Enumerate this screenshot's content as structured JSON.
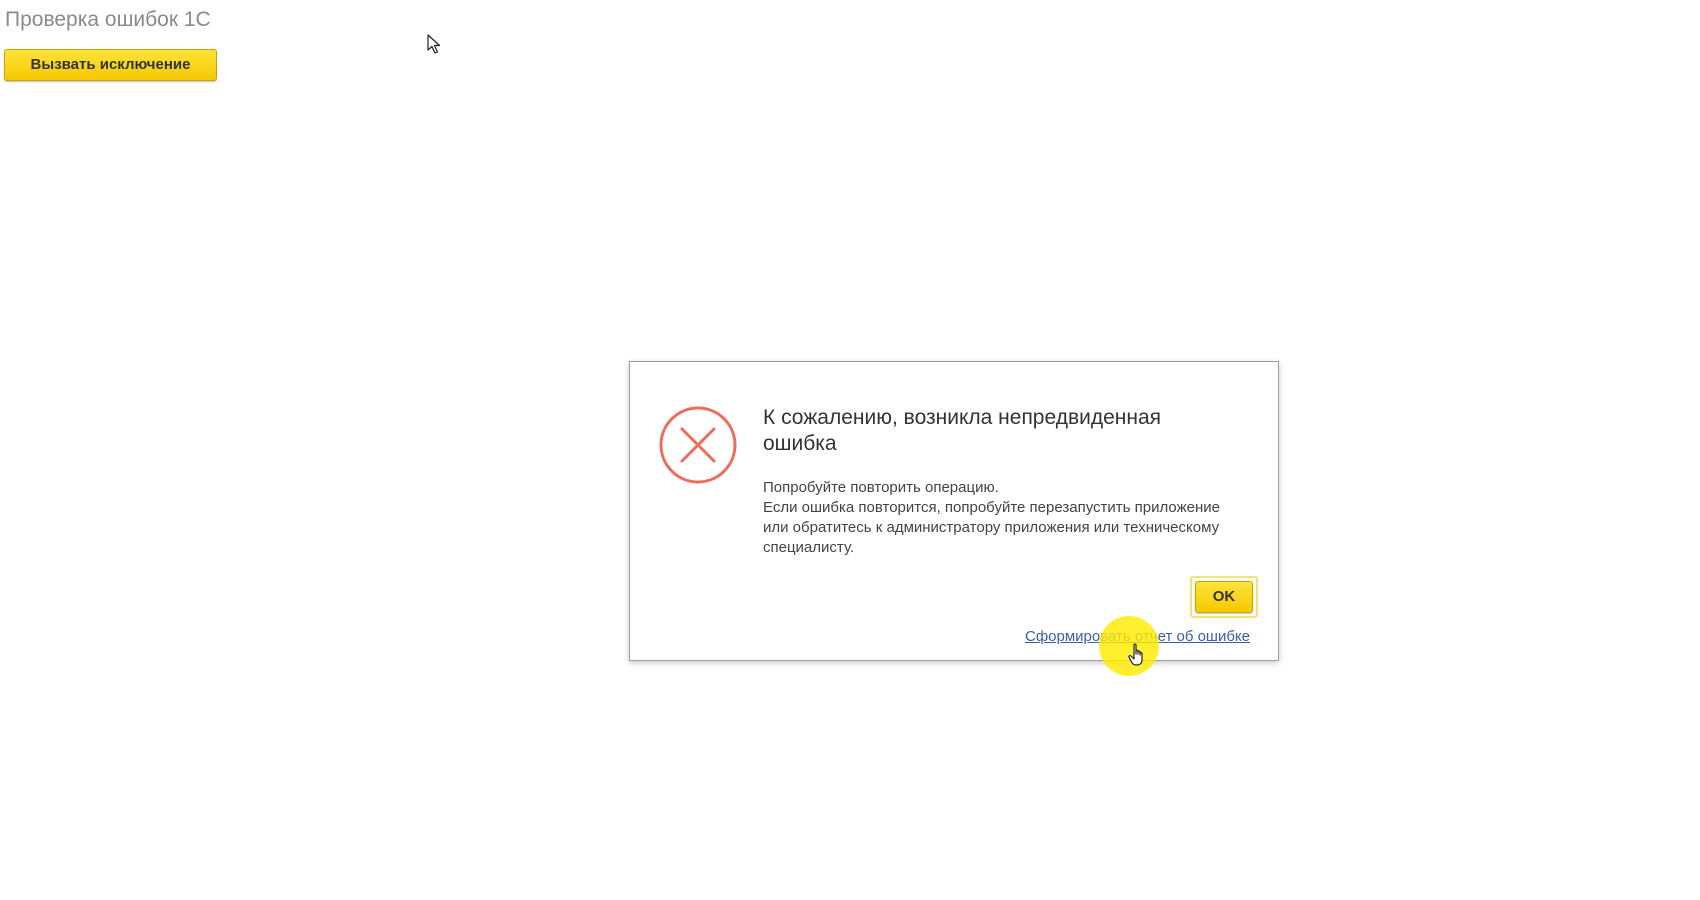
{
  "page": {
    "title": "Проверка ошибок 1С",
    "raise_button_label": "Вызвать исключение"
  },
  "dialog": {
    "icon": "error-circle-x-icon",
    "heading": "К сожалению, возникла непредвиденная ошибка",
    "message_lines": [
      "Попробуйте повторить операцию.",
      "Если ошибка повторится, попробуйте перезапустить приложение",
      "или обратитесь к администратору приложения или техническому",
      "специалисту."
    ],
    "ok_label": "OK",
    "report_link_label": "Сформировать отчет об ошибке"
  },
  "colors": {
    "accent_yellow": "#f5c800",
    "error_red": "#ef6b5c",
    "link_blue": "#3b5ea9",
    "title_gray": "#8a8a8a"
  },
  "overlay": {
    "cursor_icon": "hand-pointer-icon",
    "click_highlight": "yellow-click-highlight"
  }
}
